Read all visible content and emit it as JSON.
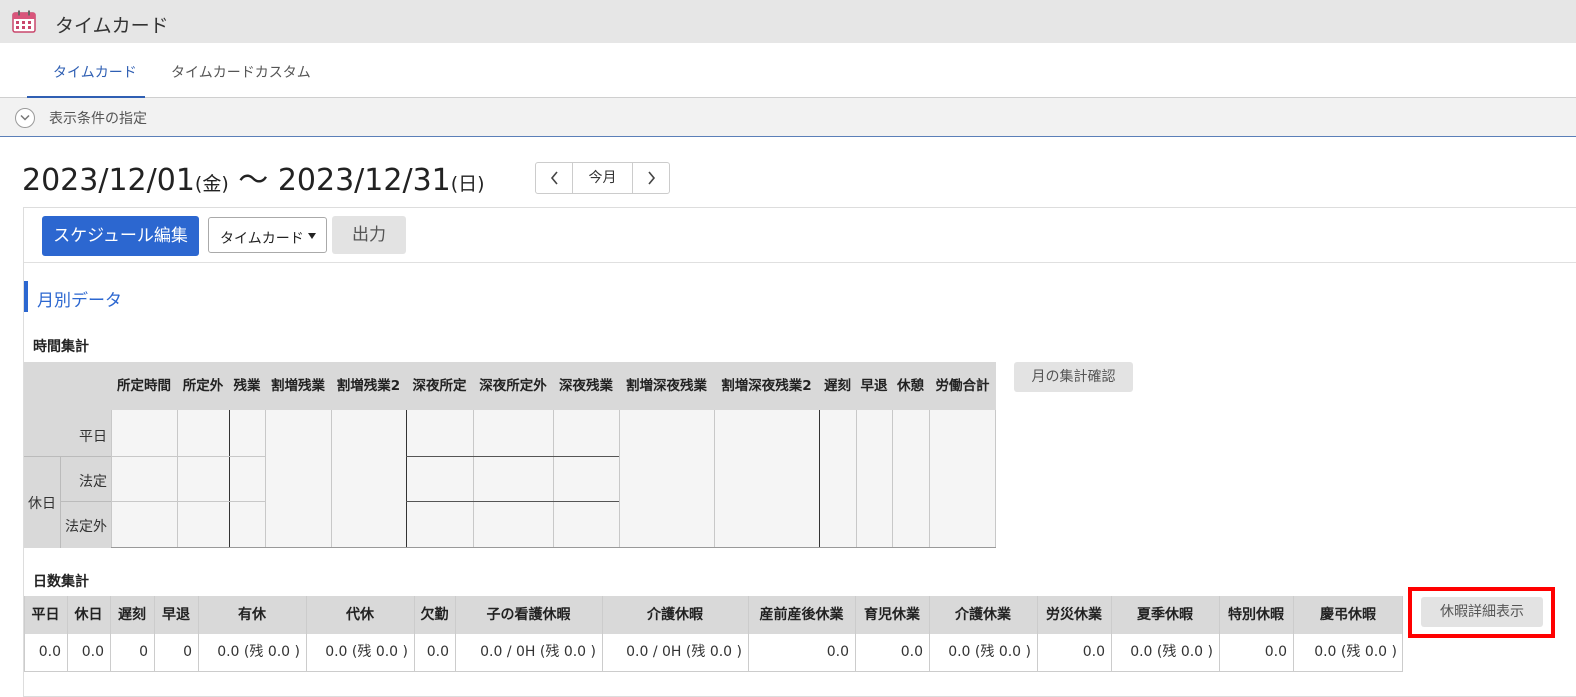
{
  "app": {
    "title": "タイムカード",
    "icon": "calendar-icon"
  },
  "tabs": [
    {
      "label": "タイムカード",
      "active": true
    },
    {
      "label": "タイムカードカスタム",
      "active": false
    }
  ],
  "filter": {
    "label": "表示条件の指定",
    "icon": "chevron-down-icon"
  },
  "period": {
    "start": "2023/12/01",
    "start_dow": "(金)",
    "separator": " 〜 ",
    "end": "2023/12/31",
    "end_dow": "(日)",
    "today_label": "今月"
  },
  "toolbar": {
    "schedule_label": "スケジュール編集",
    "select_value": "タイムカード",
    "output_label": "出力"
  },
  "section": {
    "title": "月別データ"
  },
  "time_summary": {
    "title": "時間集計",
    "columns": [
      "所定時間",
      "所定外",
      "残業",
      "割増残業",
      "割増残業2",
      "深夜所定",
      "深夜所定外",
      "深夜残業",
      "割増深夜残業",
      "割増深夜残業2",
      "遅刻",
      "早退",
      "休憩",
      "労働合計"
    ],
    "rows": {
      "weekday": "平日",
      "holiday": "休日",
      "legal": "法定",
      "non_legal": "法定外"
    },
    "confirm_label": "月の集計確認"
  },
  "day_summary": {
    "title": "日数集計",
    "columns": [
      "平日",
      "休日",
      "遅刻",
      "早退",
      "有休",
      "代休",
      "欠勤",
      "子の看護休暇",
      "介護休暇",
      "産前産後休業",
      "育児休業",
      "介護休業",
      "労災休業",
      "夏季休暇",
      "特別休暇",
      "慶弔休暇"
    ],
    "values": [
      "0.0",
      "0.0",
      "0",
      "0",
      "0.0 (残 0.0 )",
      "0.0 (残 0.0 )",
      "0.0",
      "0.0 / 0H (残 0.0 )",
      "0.0 / 0H (残 0.0 )",
      "0.0",
      "0.0",
      "0.0 (残 0.0 )",
      "0.0",
      "0.0 (残 0.0 )",
      "0.0",
      "0.0 (残 0.0 )"
    ],
    "leave_detail_label": "休暇詳細表示"
  },
  "colors": {
    "accent": "#2c67d0",
    "highlight": "#ff0000"
  }
}
